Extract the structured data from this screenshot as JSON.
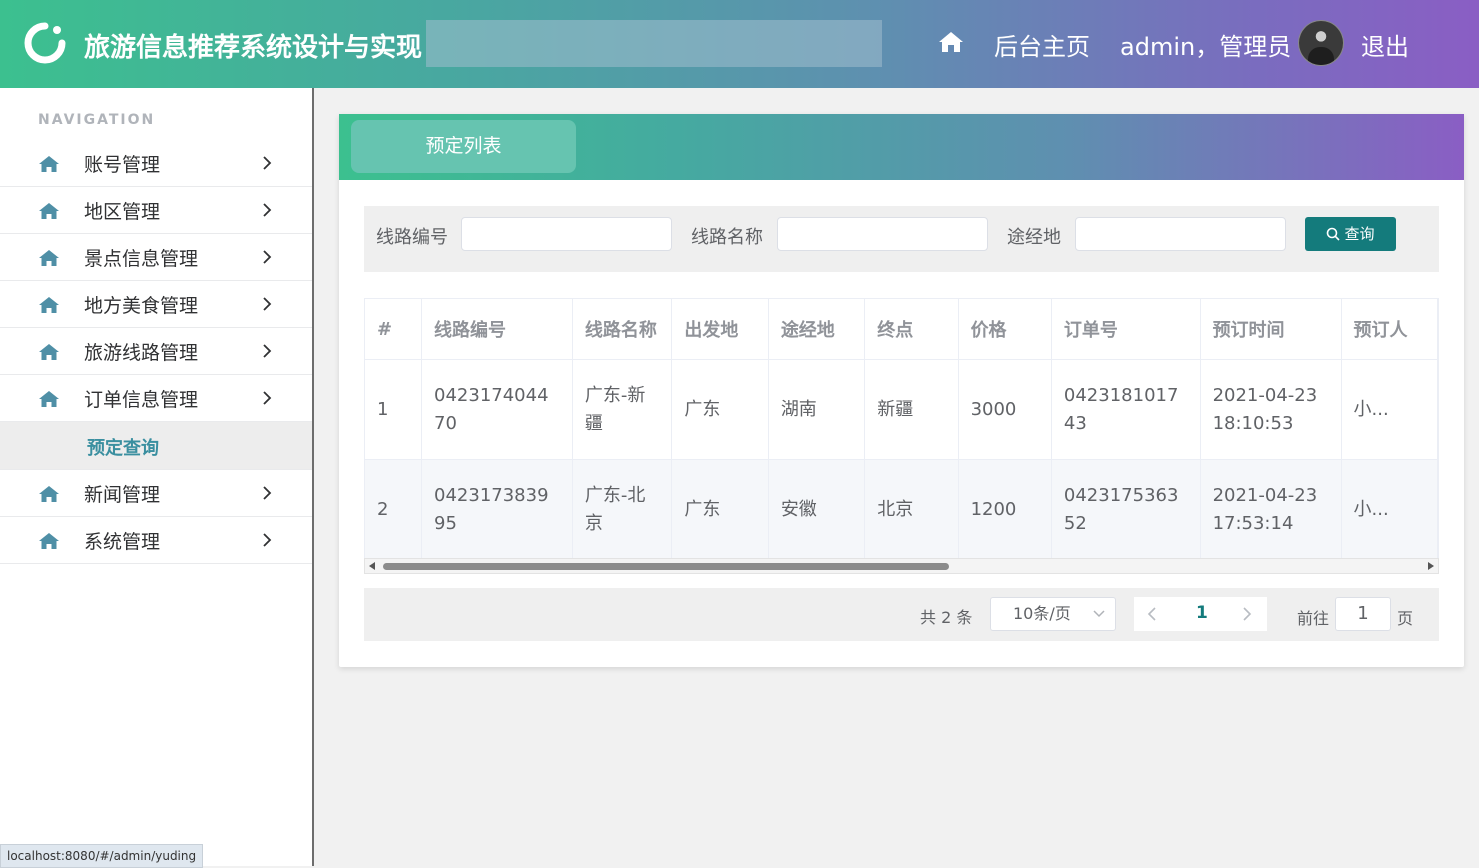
{
  "header": {
    "app_title": "旅游信息推荐系统设计与实现",
    "home_link": "后台主页",
    "user_label": "admin，管理员",
    "logout": "退出"
  },
  "sidebar": {
    "caption": "NAVIGATION",
    "items": [
      {
        "label": "账号管理"
      },
      {
        "label": "地区管理"
      },
      {
        "label": "景点信息管理"
      },
      {
        "label": "地方美食管理"
      },
      {
        "label": "旅游线路管理"
      },
      {
        "label": "订单信息管理"
      }
    ],
    "active_sub": "预定查询",
    "items_after": [
      {
        "label": "新闻管理"
      },
      {
        "label": "系统管理"
      }
    ],
    "status_url": "localhost:8080/#/admin/yuding"
  },
  "card": {
    "tab_title": "预定列表"
  },
  "search": {
    "label_route_no": "线路编号",
    "label_route_name": "线路名称",
    "label_via": "途经地",
    "route_no_value": "",
    "route_name_value": "",
    "via_value": "",
    "button": "查询"
  },
  "table": {
    "headers": [
      "#",
      "线路编号",
      "线路名称",
      "出发地",
      "途经地",
      "终点",
      "价格",
      "订单号",
      "预订时间",
      "预订人"
    ],
    "rows": [
      [
        "1",
        "042317404470",
        "广东-新疆",
        "广东",
        "湖南",
        "新疆",
        "3000",
        "042318101743",
        "2021-04-23 18:10:53",
        "小..."
      ],
      [
        "2",
        "042317383995",
        "广东-北京",
        "广东",
        "安徽",
        "北京",
        "1200",
        "042317536352",
        "2021-04-23 17:53:14",
        "小..."
      ]
    ]
  },
  "pagination": {
    "total": "共 2 条",
    "page_size": "10条/页",
    "current_page": "1",
    "goto_label": "前往",
    "goto_value": "1",
    "page_suffix": "页"
  },
  "colors": {
    "primary": "#147b7c",
    "header_start": "#3cc08f",
    "header_end": "#8a5ec4"
  }
}
